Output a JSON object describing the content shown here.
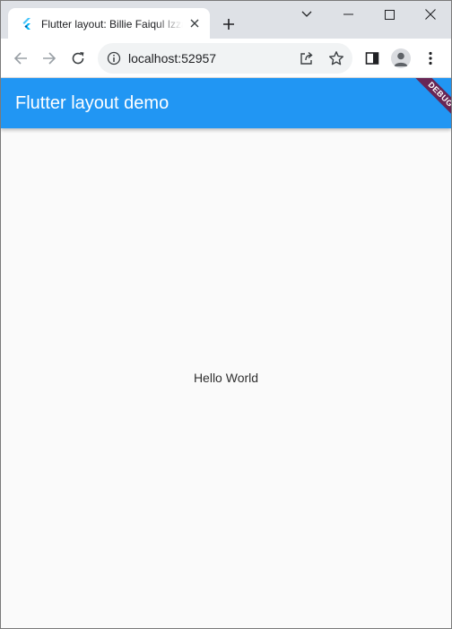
{
  "browser": {
    "tab": {
      "title": "Flutter layout: Billie Faiqul Izzah",
      "favicon": "flutter-logo-icon",
      "close_icon": "close-icon"
    },
    "new_tab_icon": "plus-icon",
    "window_controls": {
      "tab_search_icon": "chevron-down-icon",
      "minimize_icon": "minimize-icon",
      "maximize_icon": "maximize-icon",
      "close_icon": "close-icon"
    },
    "toolbar": {
      "back_icon": "arrow-left-icon",
      "forward_icon": "arrow-right-icon",
      "reload_icon": "reload-icon",
      "address": "localhost:52957",
      "site_info_icon": "info-icon",
      "share_icon": "share-icon",
      "bookmark_icon": "star-icon",
      "side_panel_icon": "side-panel-icon",
      "profile_icon": "avatar-icon",
      "menu_icon": "kebab-menu-icon"
    }
  },
  "app": {
    "appbar_title": "Flutter layout demo",
    "debug_banner": "DEBUG",
    "body_text": "Hello World"
  },
  "colors": {
    "appbar": "#2196f3",
    "body_background": "#fafafa",
    "tabstrip": "#dee1e6",
    "debug_ribbon": "#800020"
  }
}
